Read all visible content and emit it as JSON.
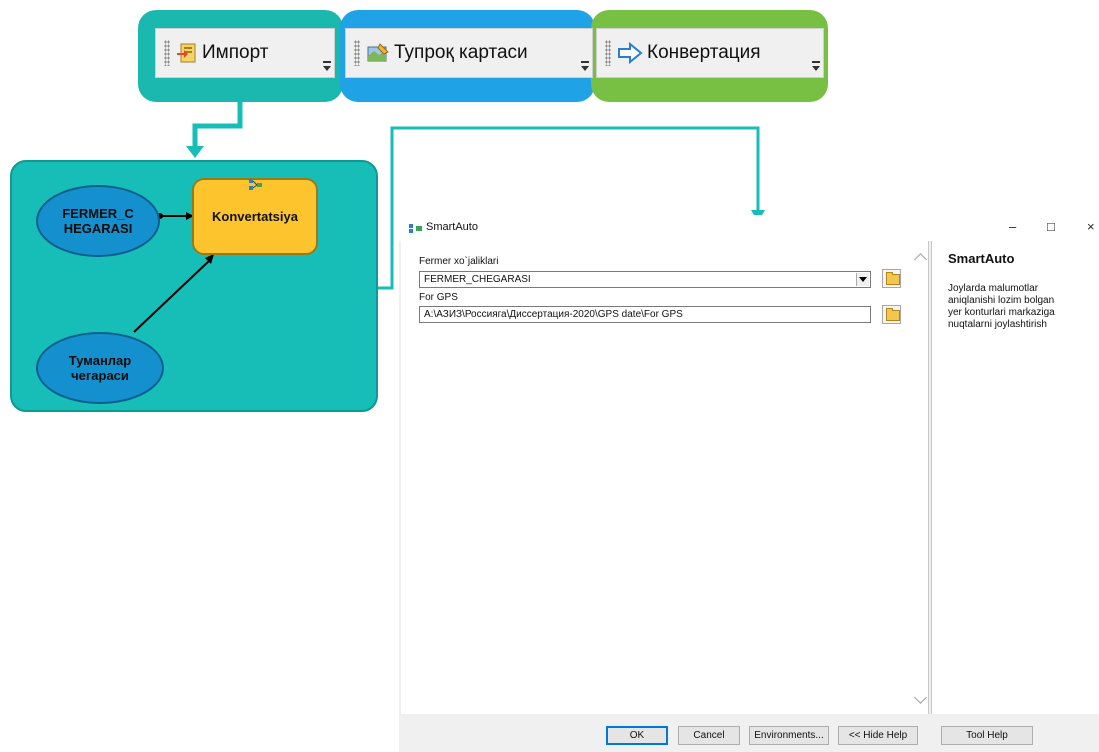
{
  "toolbars": [
    {
      "label": "Импорт",
      "icon": "import-icon"
    },
    {
      "label": "Тупроқ картаси",
      "icon": "soil-map-icon"
    },
    {
      "label": "Конвертация",
      "icon": "convert-arrow-icon"
    }
  ],
  "model": {
    "input1": "FERMER_C HEGARASI",
    "input2": "Туманлар чегараси",
    "process": "Konvertatsiya"
  },
  "dialog": {
    "title": "SmartAuto",
    "window_controls": {
      "minimize": "–",
      "maximize": "□",
      "close": "×"
    },
    "params": [
      {
        "label": "Fermer xo`jaliklari",
        "value": "FERMER_CHEGARASI",
        "kind": "combo"
      },
      {
        "label": "For GPS",
        "value": "A:\\АЗИЗ\\Россияга\\Диссертация-2020\\GPS date\\For GPS",
        "kind": "path"
      }
    ],
    "help": {
      "title": "SmartAuto",
      "lines": [
        "Joylarda malumotlar",
        "aniqlanishi lozim bolgan",
        "yer konturlari markaziga",
        "nuqtalarni joylashtirish"
      ]
    },
    "buttons": {
      "ok": "OK",
      "cancel": "Cancel",
      "environments": "Environments...",
      "hide_help": "<< Hide Help",
      "tool_help": "Tool Help"
    }
  },
  "colors": {
    "teal": "#1bb8b0",
    "blue": "#1fa3e6",
    "green": "#78c043",
    "process_yellow": "#fec42e",
    "input_blue": "#1590cf"
  }
}
